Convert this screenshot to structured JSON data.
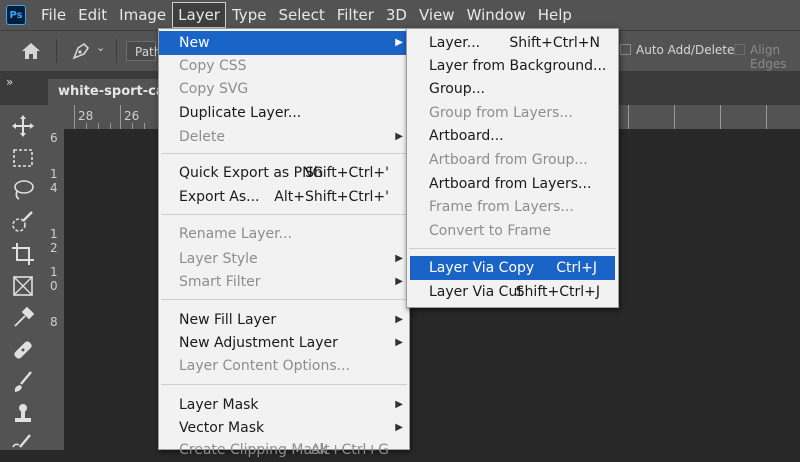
{
  "app": {
    "logo": "Ps"
  },
  "menubar": {
    "items": [
      "File",
      "Edit",
      "Image",
      "Layer",
      "Type",
      "Select",
      "Filter",
      "3D",
      "View",
      "Window",
      "Help"
    ],
    "active": "Layer"
  },
  "options": {
    "path_mode": "Path",
    "auto_add_delete": "Auto Add/Delete",
    "align_edges": "Align Edges"
  },
  "tabs": {
    "collapse": "»",
    "document": "white-sport-car-"
  },
  "rulers": {
    "top": [
      "28",
      "26"
    ],
    "left": [
      "6",
      "1",
      "4",
      "1",
      "2",
      "1",
      "0",
      "8"
    ]
  },
  "layer_menu": {
    "items": [
      {
        "label": "New",
        "submenu": true,
        "highlighted": true
      },
      {
        "label": "Copy CSS",
        "disabled": true
      },
      {
        "label": "Copy SVG",
        "disabled": true
      },
      {
        "label": "Duplicate Layer..."
      },
      {
        "label": "Delete",
        "submenu": true,
        "disabled": true
      },
      {
        "label": "Quick Export as PNG",
        "shortcut": "Shift+Ctrl+'"
      },
      {
        "label": "Export As...",
        "shortcut": "Alt+Shift+Ctrl+'"
      },
      {
        "label": "Rename Layer...",
        "disabled": true
      },
      {
        "label": "Layer Style",
        "submenu": true,
        "disabled": true
      },
      {
        "label": "Smart Filter",
        "submenu": true,
        "disabled": true
      },
      {
        "label": "New Fill Layer",
        "submenu": true
      },
      {
        "label": "New Adjustment Layer",
        "submenu": true
      },
      {
        "label": "Layer Content Options...",
        "disabled": true
      },
      {
        "label": "Layer Mask",
        "submenu": true
      },
      {
        "label": "Vector Mask",
        "submenu": true
      },
      {
        "label": "Create Clipping Mask",
        "shortcut": "Alt+Ctrl+G",
        "disabled": true
      }
    ]
  },
  "new_submenu": {
    "items": [
      {
        "label": "Layer...",
        "shortcut": "Shift+Ctrl+N"
      },
      {
        "label": "Layer from Background..."
      },
      {
        "label": "Group..."
      },
      {
        "label": "Group from Layers...",
        "disabled": true
      },
      {
        "label": "Artboard..."
      },
      {
        "label": "Artboard from Group...",
        "disabled": true
      },
      {
        "label": "Artboard from Layers..."
      },
      {
        "label": "Frame from Layers...",
        "disabled": true
      },
      {
        "label": "Convert to Frame",
        "disabled": true
      },
      {
        "label": "Layer Via Copy",
        "shortcut": "Ctrl+J",
        "highlighted": true
      },
      {
        "label": "Layer Via Cut",
        "shortcut": "Shift+Ctrl+J"
      }
    ]
  },
  "colors": {
    "highlight": "#1a64c7",
    "menu_bg": "#f2f2f2",
    "chrome": "#535353",
    "canvas": "#282828"
  }
}
